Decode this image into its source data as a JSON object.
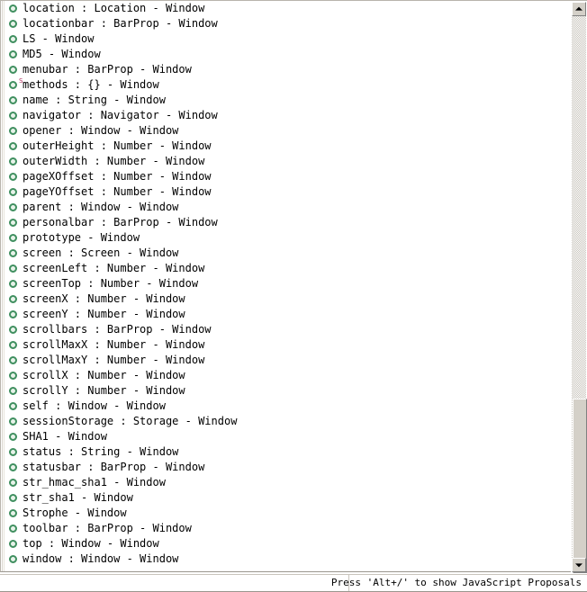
{
  "window_kind": "javascript-content-assist-popup",
  "icons": {
    "bullet": "public-member-icon",
    "scroll_up": "chevron-up-icon",
    "scroll_down": "chevron-down-icon"
  },
  "colors": {
    "bullet_green": "#3f8f5f",
    "badge_pink": "#b03060",
    "text": "#000000",
    "background": "#ffffff",
    "scrollbar_face": "#d4d0c8"
  },
  "proposals": [
    {
      "text": "location : Location - Window",
      "badge": ""
    },
    {
      "text": "locationbar : BarProp - Window",
      "badge": ""
    },
    {
      "text": "LS - Window",
      "badge": ""
    },
    {
      "text": "MD5 - Window",
      "badge": ""
    },
    {
      "text": "menubar : BarProp - Window",
      "badge": ""
    },
    {
      "text": "methods : {} - Window",
      "badge": "S"
    },
    {
      "text": "name : String - Window",
      "badge": ""
    },
    {
      "text": "navigator : Navigator - Window",
      "badge": ""
    },
    {
      "text": "opener : Window - Window",
      "badge": ""
    },
    {
      "text": "outerHeight : Number - Window",
      "badge": ""
    },
    {
      "text": "outerWidth : Number - Window",
      "badge": ""
    },
    {
      "text": "pageXOffset : Number - Window",
      "badge": ""
    },
    {
      "text": "pageYOffset : Number - Window",
      "badge": ""
    },
    {
      "text": "parent : Window - Window",
      "badge": ""
    },
    {
      "text": "personalbar : BarProp - Window",
      "badge": ""
    },
    {
      "text": "prototype - Window",
      "badge": ""
    },
    {
      "text": "screen : Screen - Window",
      "badge": ""
    },
    {
      "text": "screenLeft : Number - Window",
      "badge": ""
    },
    {
      "text": "screenTop : Number - Window",
      "badge": ""
    },
    {
      "text": "screenX : Number - Window",
      "badge": ""
    },
    {
      "text": "screenY : Number - Window",
      "badge": ""
    },
    {
      "text": "scrollbars : BarProp - Window",
      "badge": ""
    },
    {
      "text": "scrollMaxX : Number - Window",
      "badge": ""
    },
    {
      "text": "scrollMaxY : Number - Window",
      "badge": ""
    },
    {
      "text": "scrollX : Number - Window",
      "badge": ""
    },
    {
      "text": "scrollY : Number - Window",
      "badge": ""
    },
    {
      "text": "self : Window - Window",
      "badge": ""
    },
    {
      "text": "sessionStorage : Storage - Window",
      "badge": ""
    },
    {
      "text": "SHA1 - Window",
      "badge": ""
    },
    {
      "text": "status : String - Window",
      "badge": ""
    },
    {
      "text": "statusbar : BarProp - Window",
      "badge": ""
    },
    {
      "text": "str_hmac_sha1 - Window",
      "badge": ""
    },
    {
      "text": "str_sha1 - Window",
      "badge": ""
    },
    {
      "text": "Strophe - Window",
      "badge": ""
    },
    {
      "text": "toolbar : BarProp - Window",
      "badge": ""
    },
    {
      "text": "top : Window - Window",
      "badge": ""
    },
    {
      "text": "window : Window - Window",
      "badge": ""
    }
  ],
  "status_bar": {
    "hint": "Press 'Alt+/' to show JavaScript Proposals"
  },
  "scrollbar": {
    "up_glyph": "▲",
    "down_glyph": "▼"
  }
}
